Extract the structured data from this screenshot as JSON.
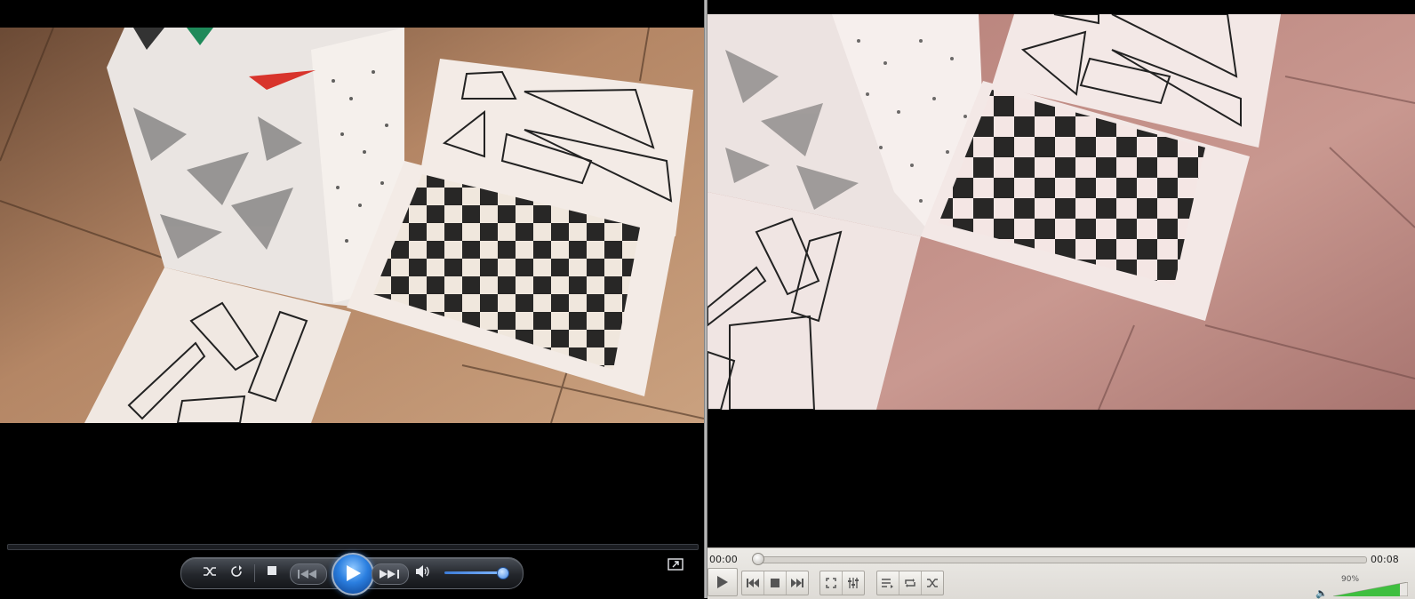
{
  "left_player": {
    "style": "windows-media-player",
    "controls": {
      "shuffle_icon": "shuffle-icon",
      "repeat_icon": "repeat-icon",
      "stop_icon": "stop-icon",
      "previous_icon": "previous-icon",
      "play_icon": "play-icon",
      "next_icon": "next-icon",
      "mute_icon": "speaker-icon",
      "switch_icon": "switch-to-library-icon"
    },
    "volume_level": 0.85
  },
  "right_player": {
    "style": "vlc",
    "time_elapsed": "00:00",
    "time_total": "00:08",
    "volume_label": "90%",
    "volume_level": 0.9,
    "controls": {
      "play_icon": "play-icon",
      "previous_icon": "previous-icon",
      "stop_icon": "stop-icon",
      "next_icon": "next-icon",
      "fullscreen_icon": "fullscreen-icon",
      "extended_icon": "equalizer-icon",
      "playlist_icon": "playlist-icon",
      "loop_icon": "loop-icon",
      "random_icon": "shuffle-icon"
    }
  },
  "colors": {
    "wmp_accent": "#2b7fe0",
    "vlc_volume_green": "#3fbf3f",
    "video_floor": "#b88a66"
  }
}
